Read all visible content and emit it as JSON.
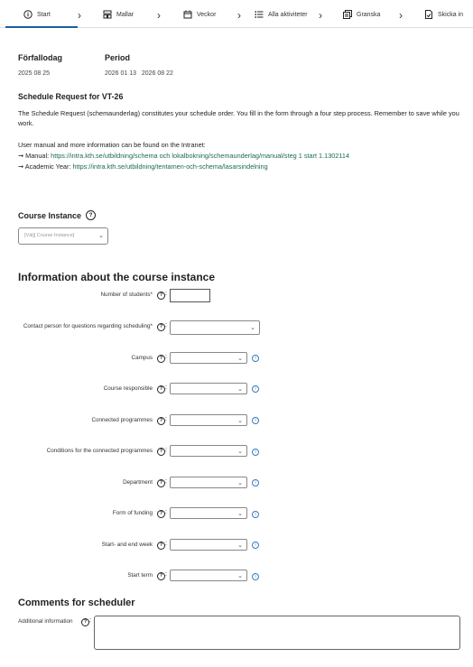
{
  "nav": {
    "steps": [
      {
        "label": "Start",
        "icon": "info-circle-icon"
      },
      {
        "label": "Mallar",
        "icon": "template-icon"
      },
      {
        "label": "Veckor",
        "icon": "calendar-icon"
      },
      {
        "label": "Alla aktiviteter",
        "icon": "list-icon"
      },
      {
        "label": "Granska",
        "icon": "review-icon"
      },
      {
        "label": "Skicka in",
        "icon": "submit-icon"
      }
    ],
    "active_step": "Start"
  },
  "meta": {
    "due_label": "Förfallodag",
    "due_value": "2025 08 25",
    "period_label": "Period",
    "period_value": "2026 01 13   2026 08 22"
  },
  "intro": {
    "title": "Schedule Request for VT-26",
    "body": "The Schedule Request (schemaunderlag) constitutes your schedule order. You fill in the form through a four step process. Remember to save while you work.",
    "manual_intro": "User manual and more information can be found on the Intranet:",
    "manual_label": "➞ Manual: ",
    "manual_link": "https://intra.kth.se/utbildning/schema och lokalbokning/schemaunderlag/manual/steg 1 start 1.1302114",
    "year_label": "➞ Academic Year: ",
    "year_link": "https://intra.kth.se/utbildning/tentamen-och-schema/lasarsindelning"
  },
  "course_instance": {
    "label": "Course Instance",
    "placeholder": "[Välj] Course Instance]"
  },
  "info_section": {
    "title": "Information about the course instance",
    "fields": [
      {
        "label": "Number of students*",
        "type": "input"
      },
      {
        "label": "Contact person for questions regarding scheduling*",
        "type": "select"
      },
      {
        "label": "Campus",
        "type": "select"
      },
      {
        "label": "Course responsible",
        "type": "select"
      },
      {
        "label": "Connected programmes",
        "type": "select"
      },
      {
        "label": "Conditions for the connected programmes",
        "type": "select"
      },
      {
        "label": "Department",
        "type": "select"
      },
      {
        "label": "Form of funding",
        "type": "select"
      },
      {
        "label": "Start- and end week",
        "type": "select"
      },
      {
        "label": "Start term",
        "type": "select"
      }
    ]
  },
  "comments": {
    "title": "Comments for scheduler",
    "additional_label": "Additional information"
  },
  "colors": {
    "accent": "#1b5e9e",
    "link": "#1a6b4a",
    "info": "#3a7bbf"
  }
}
